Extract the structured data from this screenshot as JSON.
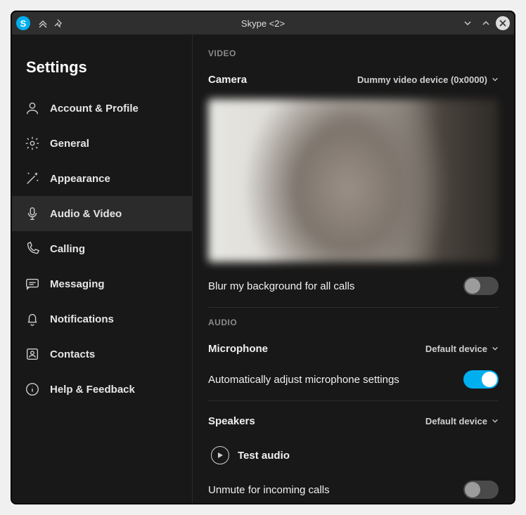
{
  "window": {
    "title": "Skype <2>",
    "app_initial": "S"
  },
  "sidebar": {
    "title": "Settings",
    "items": [
      {
        "label": "Account & Profile",
        "icon": "account-icon",
        "active": false
      },
      {
        "label": "General",
        "icon": "gear-icon",
        "active": false
      },
      {
        "label": "Appearance",
        "icon": "wand-icon",
        "active": false
      },
      {
        "label": "Audio & Video",
        "icon": "microphone-icon",
        "active": true
      },
      {
        "label": "Calling",
        "icon": "phone-icon",
        "active": false
      },
      {
        "label": "Messaging",
        "icon": "chat-icon",
        "active": false
      },
      {
        "label": "Notifications",
        "icon": "bell-icon",
        "active": false
      },
      {
        "label": "Contacts",
        "icon": "contacts-icon",
        "active": false
      },
      {
        "label": "Help & Feedback",
        "icon": "info-icon",
        "active": false
      }
    ]
  },
  "main": {
    "video": {
      "section_label": "VIDEO",
      "camera_label": "Camera",
      "camera_value": "Dummy video device (0x0000)",
      "blur_label": "Blur my background for all calls",
      "blur_on": false
    },
    "audio": {
      "section_label": "AUDIO",
      "mic_label": "Microphone",
      "mic_value": "Default device",
      "auto_adjust_label": "Automatically adjust microphone settings",
      "auto_adjust_on": true,
      "speakers_label": "Speakers",
      "speakers_value": "Default device",
      "test_audio_label": "Test audio",
      "unmute_label": "Unmute for incoming calls",
      "unmute_on": false
    }
  }
}
